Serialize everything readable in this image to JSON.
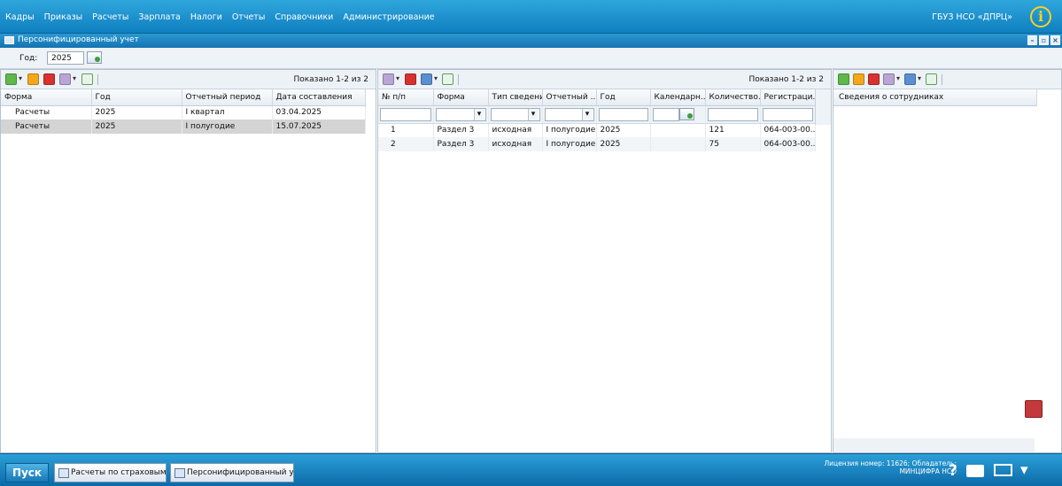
{
  "menu": [
    "Кадры",
    "Приказы",
    "Расчеты",
    "Зарплата",
    "Налоги",
    "Отчеты",
    "Справочники",
    "Администрирование"
  ],
  "org_name": "ГБУЗ НСО «ДПРЦ»",
  "window": {
    "title": "Персонифицированный учет"
  },
  "year": {
    "label": "Год:",
    "value": "2025"
  },
  "left_panel": {
    "shown": "Показано 1-2 из 2",
    "columns": [
      "Форма",
      "Год",
      "Отчетный период",
      "Дата составления"
    ],
    "rows": [
      [
        "Расчеты",
        "2025",
        "I квартал",
        "03.04.2025"
      ],
      [
        "Расчеты",
        "2025",
        "I полугодие",
        "15.07.2025"
      ]
    ]
  },
  "mid_panel": {
    "shown": "Показано 1-2 из 2",
    "columns": [
      "№ п/п",
      "Форма",
      "Тип сведений",
      "Отчетный ...",
      "Год",
      "Календарн...",
      "Количество...",
      "Регистраци..."
    ],
    "rows": [
      [
        "1",
        "Раздел 3",
        "исходная",
        "I полугодие",
        "2025",
        "",
        "121",
        "064-003-00..."
      ],
      [
        "2",
        "Раздел 3",
        "исходная",
        "I полугодие",
        "2025",
        "",
        "75",
        "064-003-00..."
      ]
    ]
  },
  "right_panel": {
    "column": "Сведения о сотрудниках"
  },
  "taskbar": {
    "start": "Пуск",
    "tasks": [
      "Расчеты по страховым в...",
      "Персонифицированный учет"
    ],
    "license_line1": "Лицензия номер: 11626; Обладатель:",
    "license_line2": "МИНЦИФРА НСО"
  }
}
